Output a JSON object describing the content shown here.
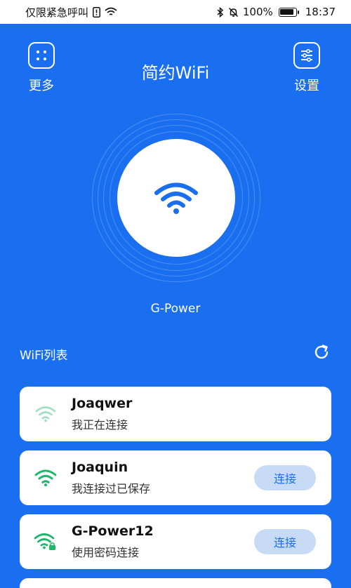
{
  "status_bar": {
    "left_text": "仅限紧急呼叫",
    "battery": "100%",
    "time": "18:37"
  },
  "header": {
    "more_label": "更多",
    "title": "简约WiFi",
    "settings_label": "设置"
  },
  "hero": {
    "current_ssid": "G-Power"
  },
  "list": {
    "title": "WiFi列表",
    "connect_label": "连接",
    "items": [
      {
        "ssid": "Joaqwer",
        "status": "我正在连接"
      },
      {
        "ssid": "Joaquin",
        "status": "我连接过已保存"
      },
      {
        "ssid": "G-Power12",
        "status": "使用密码连接"
      }
    ]
  },
  "colors": {
    "background": "#1a6ff0",
    "wifi_green": "#1fb86b",
    "wifi_green_light": "#9fe0c0",
    "connect_bg": "#c7daf6"
  }
}
